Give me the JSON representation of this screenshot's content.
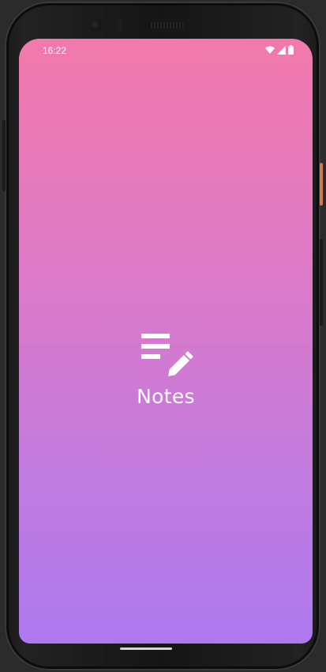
{
  "status_bar": {
    "time": "16:22",
    "icons": [
      "wifi-icon",
      "cellular-signal-icon",
      "battery-icon"
    ]
  },
  "splash": {
    "icon": "notes-edit-icon",
    "title": "Notes"
  },
  "colors": {
    "gradient_top": "#f279ab",
    "gradient_bottom": "#ad79ef",
    "text": "#ffffff"
  }
}
